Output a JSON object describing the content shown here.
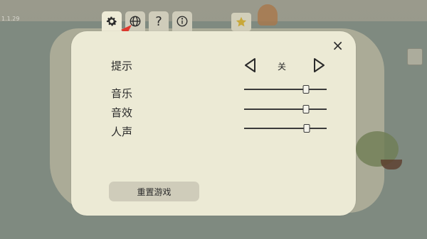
{
  "version": "1.1.29",
  "tabs": [
    {
      "name": "settings",
      "icon": "gear-icon",
      "active": true
    },
    {
      "name": "language",
      "icon": "globe-icon",
      "active": false
    },
    {
      "name": "help",
      "label": "?",
      "active": false
    },
    {
      "name": "info",
      "icon": "info-icon",
      "active": false
    },
    {
      "name": "achievements",
      "icon": "star-icon",
      "active": false
    }
  ],
  "panel": {
    "close_label": "×",
    "hint": {
      "label": "提示",
      "value": "关"
    },
    "sliders": [
      {
        "label": "音乐",
        "level": 0.75
      },
      {
        "label": "音效",
        "level": 0.75
      },
      {
        "label": "人声",
        "level": 0.76
      }
    ],
    "reset_label": "重置游戏"
  },
  "colors": {
    "panel_bg": "#ecead5",
    "tab_active": "#eeebd7",
    "tab_inactive": "#cfccba",
    "arrow": "#e03a2f"
  }
}
